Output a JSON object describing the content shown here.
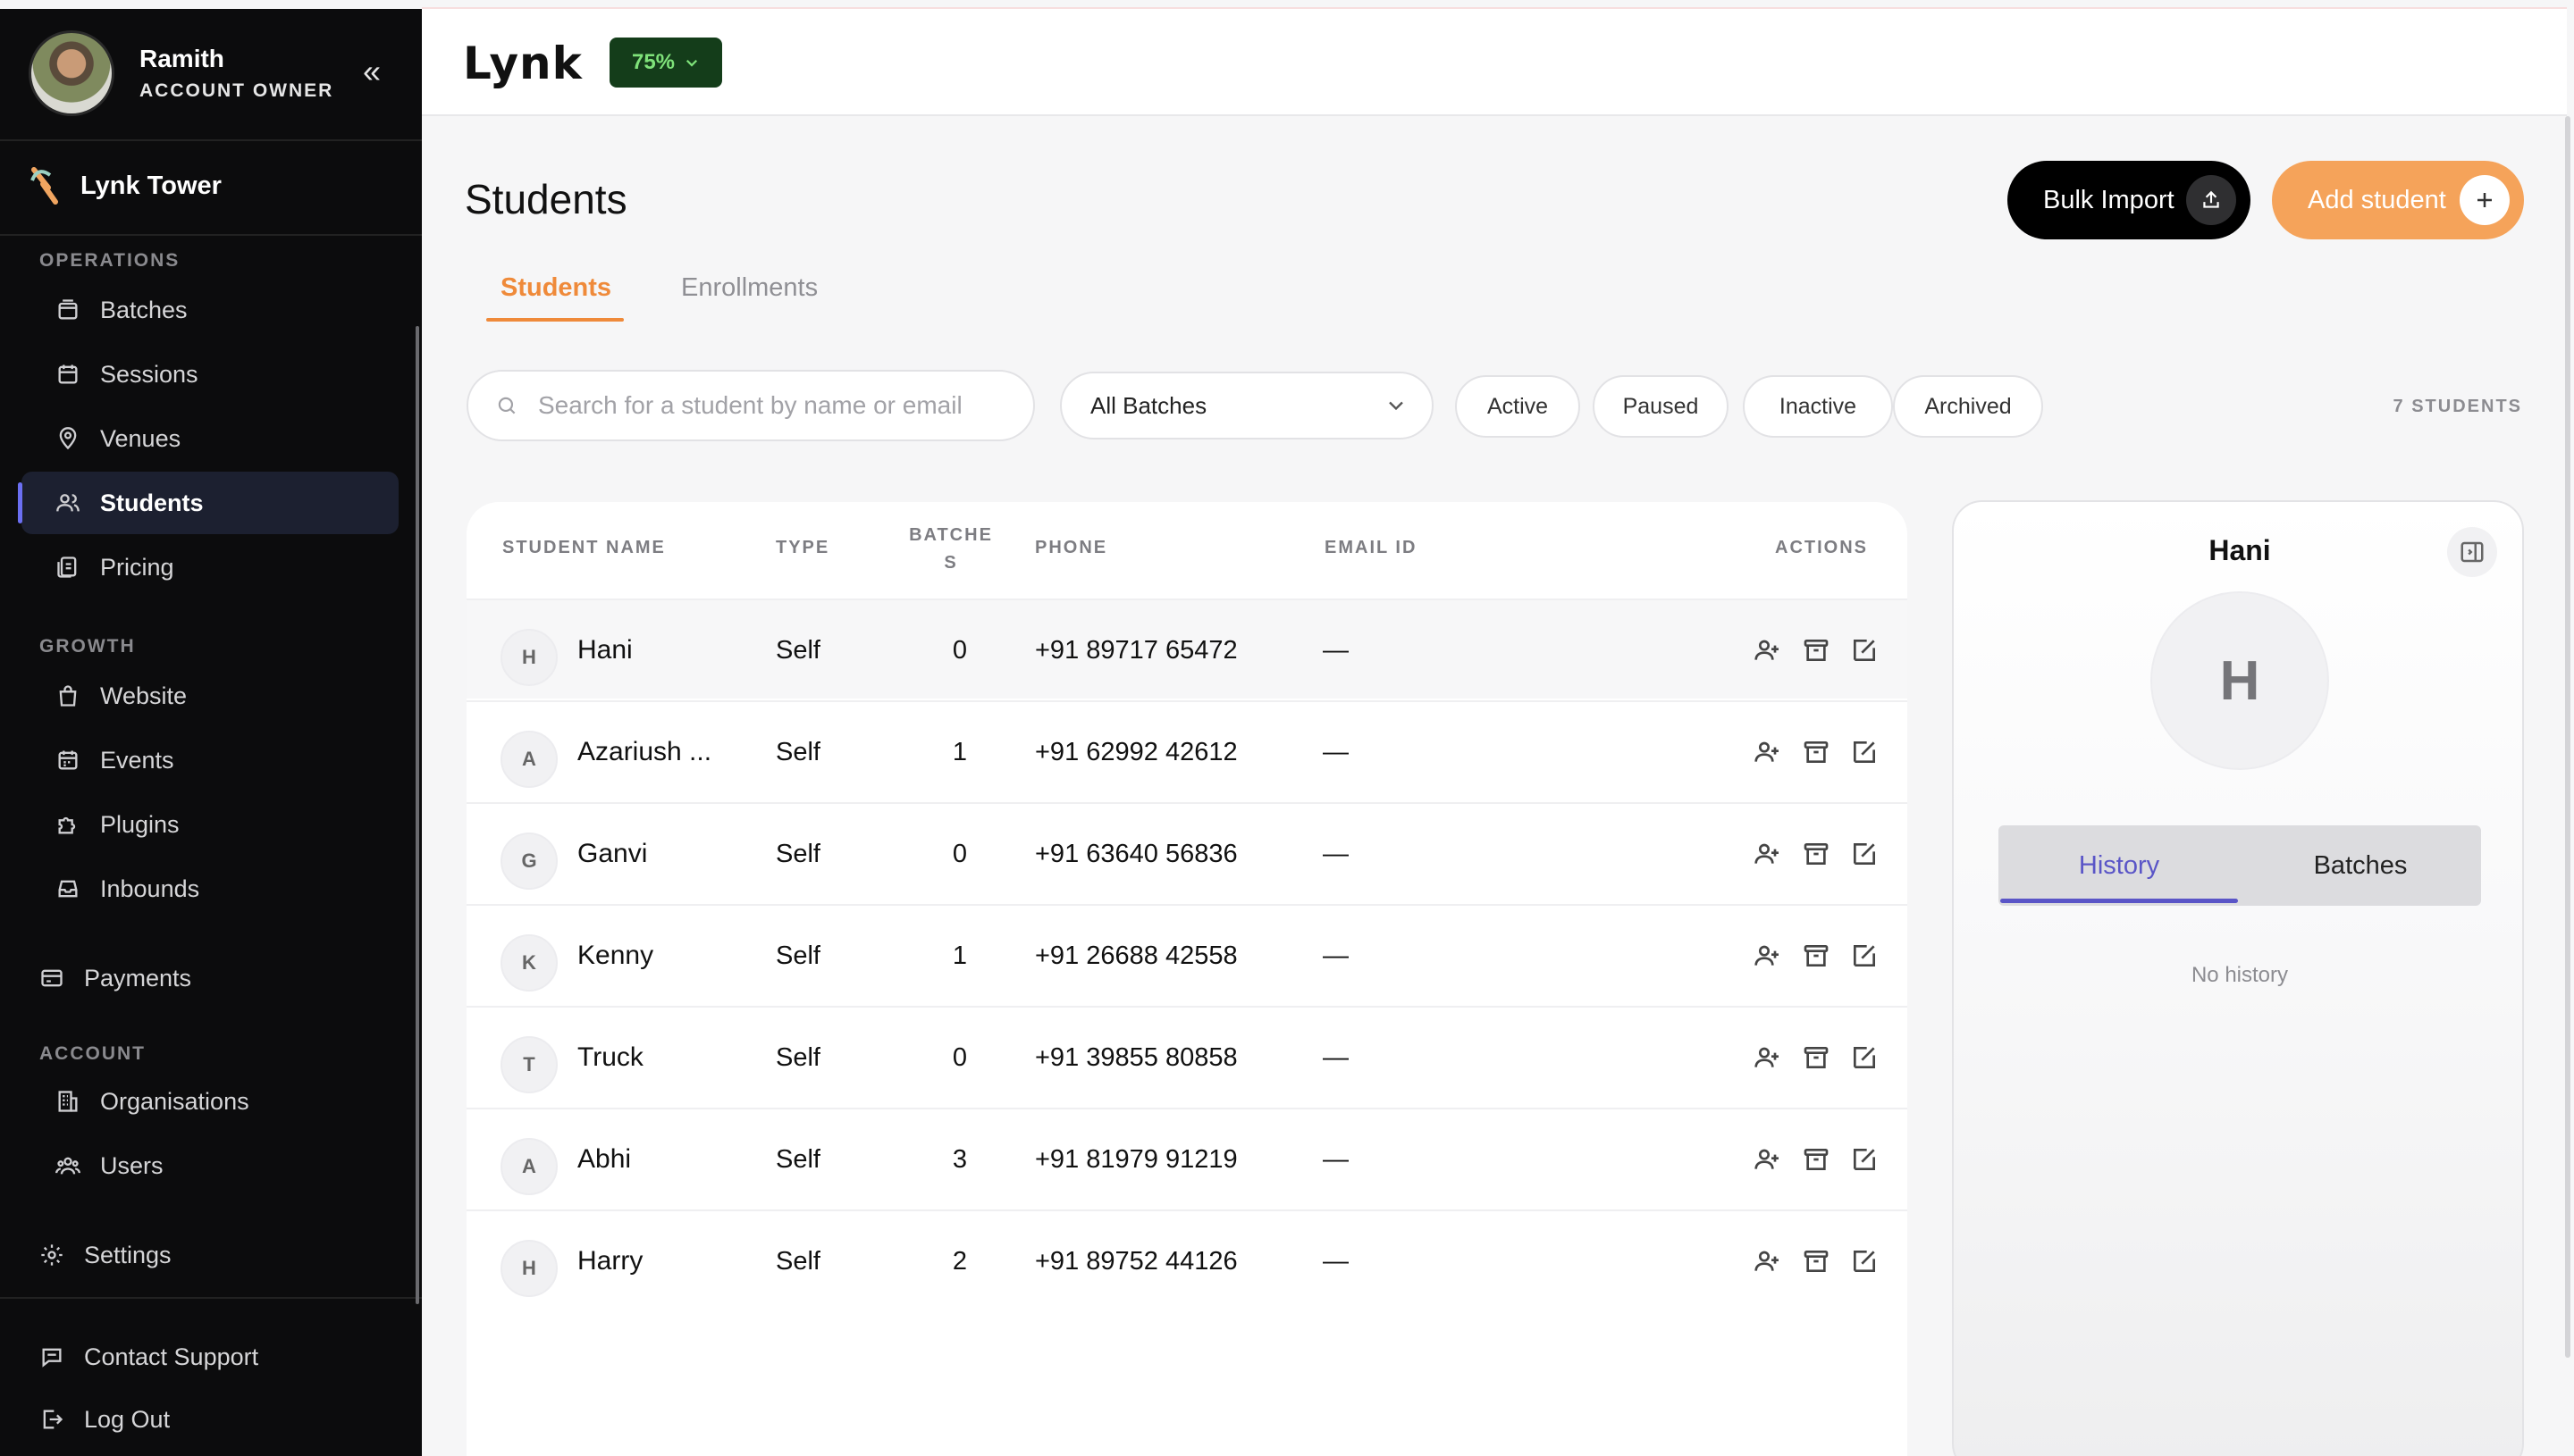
{
  "user": {
    "name": "Ramith",
    "role": "ACCOUNT OWNER"
  },
  "brand": {
    "name": "Lynk Tower"
  },
  "sidebar": {
    "sections": {
      "operations": "OPERATIONS",
      "growth": "GROWTH",
      "account": "ACCOUNT"
    },
    "items": [
      {
        "label": "Batches",
        "icon": "archive-icon"
      },
      {
        "label": "Sessions",
        "icon": "calendar-icon"
      },
      {
        "label": "Venues",
        "icon": "map-pin-icon"
      },
      {
        "label": "Students",
        "icon": "users-icon"
      },
      {
        "label": "Pricing",
        "icon": "tag-icon"
      },
      {
        "label": "Website",
        "icon": "shopping-bag-icon"
      },
      {
        "label": "Events",
        "icon": "calendar-days-icon"
      },
      {
        "label": "Plugins",
        "icon": "puzzle-icon"
      },
      {
        "label": "Inbounds",
        "icon": "inbox-icon"
      },
      {
        "label": "Payments",
        "icon": "credit-card-icon"
      },
      {
        "label": "Organisations",
        "icon": "building-icon"
      },
      {
        "label": "Users",
        "icon": "users-group-icon"
      },
      {
        "label": "Settings",
        "icon": "gear-icon"
      }
    ],
    "footer": {
      "support": "Contact Support",
      "logout": "Log Out"
    }
  },
  "topbar": {
    "logo": "Lynk",
    "progress_label": "75%",
    "progress_color": "#143d1a"
  },
  "page": {
    "title": "Students",
    "bulk_import": "Bulk Import",
    "add_student": "Add student",
    "tabs": [
      "Students",
      "Enrollments"
    ],
    "search_placeholder": "Search for a student by name or email",
    "batch_filter": "All Batches",
    "status_filters": [
      "Active",
      "Paused",
      "Inactive",
      "Archived"
    ],
    "count": "7 STUDENTS"
  },
  "table": {
    "headers": {
      "name": "STUDENT NAME",
      "type": "TYPE",
      "batches_1": "BATCHE",
      "batches_2": "S",
      "phone": "PHONE",
      "email": "EMAIL ID",
      "actions": "ACTIONS"
    },
    "rows": [
      {
        "initial": "H",
        "name": "Hani",
        "type": "Self",
        "batches": "0",
        "phone": "+91 89717 65472",
        "email": "—"
      },
      {
        "initial": "A",
        "name": "Azariush ...",
        "type": "Self",
        "batches": "1",
        "phone": "+91 62992 42612",
        "email": "—"
      },
      {
        "initial": "G",
        "name": "Ganvi",
        "type": "Self",
        "batches": "0",
        "phone": "+91 63640 56836",
        "email": "—"
      },
      {
        "initial": "K",
        "name": "Kenny",
        "type": "Self",
        "batches": "1",
        "phone": "+91 26688 42558",
        "email": "—"
      },
      {
        "initial": "T",
        "name": "Truck",
        "type": "Self",
        "batches": "0",
        "phone": "+91 39855 80858",
        "email": "—"
      },
      {
        "initial": "A",
        "name": "Abhi",
        "type": "Self",
        "batches": "3",
        "phone": "+91 81979 91219",
        "email": "—"
      },
      {
        "initial": "H",
        "name": "Harry",
        "type": "Self",
        "batches": "2",
        "phone": "+91 89752 44126",
        "email": "—"
      }
    ]
  },
  "detail": {
    "name": "Hani",
    "initial": "H",
    "tabs": [
      "History",
      "Batches"
    ],
    "empty": "No history"
  },
  "colors": {
    "accent": "#ef8a3a",
    "primary_button": "#f5a35a",
    "active_nav": "#1c2030",
    "tab_active": "#5a55c7"
  }
}
